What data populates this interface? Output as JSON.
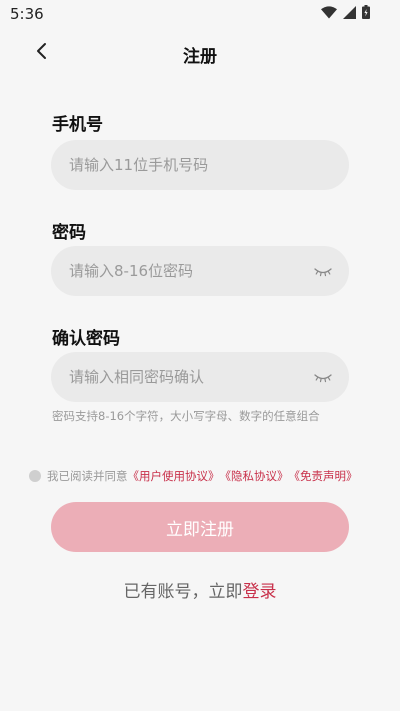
{
  "status_bar": {
    "time": "5:36"
  },
  "header": {
    "title": "注册"
  },
  "form": {
    "phone": {
      "label": "手机号",
      "placeholder": "请输入11位手机号码",
      "value": ""
    },
    "password": {
      "label": "密码",
      "placeholder": "请输入8-16位密码",
      "value": ""
    },
    "confirm": {
      "label": "确认密码",
      "placeholder": "请输入相同密码确认",
      "value": ""
    },
    "hint": "密码支持8-16个字符，大小写字母、数字的任意组合"
  },
  "agreement": {
    "prefix": "我已阅读并同意",
    "user_agreement": "《用户使用协议》",
    "privacy": "《隐私协议》",
    "disclaimer": "《免责声明》"
  },
  "register_button": {
    "label": "立即注册"
  },
  "login": {
    "prompt": "已有账号，立即",
    "link": "登录"
  },
  "colors": {
    "accent": "#c8304a",
    "button": "#ecaeb7",
    "input_bg": "#eaeaea",
    "background": "#f6f6f6"
  },
  "icons": {
    "back": "chevron-left-icon",
    "eye": "eye-closed-icon",
    "wifi": "wifi-icon",
    "signal": "signal-icon",
    "battery": "battery-icon"
  }
}
